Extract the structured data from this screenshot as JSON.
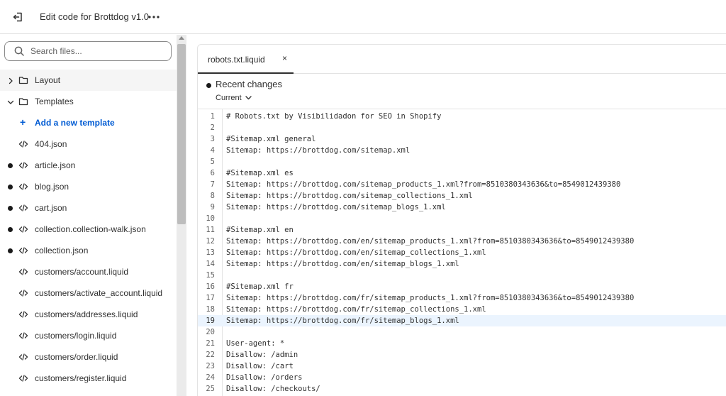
{
  "topbar": {
    "title": "Edit code for Brottdog v1.0",
    "exit_icon": "exit-icon",
    "more_icon": "more-horizontal-icon"
  },
  "sidebar": {
    "search_placeholder": "Search files...",
    "items": [
      {
        "type": "folder",
        "label": "Layout",
        "expanded": false
      },
      {
        "type": "folder",
        "label": "Templates",
        "expanded": true
      },
      {
        "type": "action",
        "label": "Add a new template"
      },
      {
        "type": "file",
        "label": "404.json",
        "modified": false
      },
      {
        "type": "file",
        "label": "article.json",
        "modified": true
      },
      {
        "type": "file",
        "label": "blog.json",
        "modified": true
      },
      {
        "type": "file",
        "label": "cart.json",
        "modified": true
      },
      {
        "type": "file",
        "label": "collection.collection-walk.json",
        "modified": true
      },
      {
        "type": "file",
        "label": "collection.json",
        "modified": true
      },
      {
        "type": "file",
        "label": "customers/account.liquid",
        "modified": false
      },
      {
        "type": "file",
        "label": "customers/activate_account.liquid",
        "modified": false
      },
      {
        "type": "file",
        "label": "customers/addresses.liquid",
        "modified": false
      },
      {
        "type": "file",
        "label": "customers/login.liquid",
        "modified": false
      },
      {
        "type": "file",
        "label": "customers/order.liquid",
        "modified": false
      },
      {
        "type": "file",
        "label": "customers/register.liquid",
        "modified": false
      }
    ]
  },
  "editor": {
    "tab_label": "robots.txt.liquid",
    "tab_close": "×",
    "changes_title": "Recent changes",
    "version": "Current",
    "active_line": 19,
    "lines": [
      "# Robots.txt by Visibilidadon for SEO in Shopify",
      "",
      "#Sitemap.xml general",
      "Sitemap: https://brottdog.com/sitemap.xml",
      "",
      "#Sitemap.xml es",
      "Sitemap: https://brottdog.com/sitemap_products_1.xml?from=8510380343636&to=8549012439380",
      "Sitemap: https://brottdog.com/sitemap_collections_1.xml",
      "Sitemap: https://brottdog.com/sitemap_blogs_1.xml",
      "",
      "#Sitemap.xml en",
      "Sitemap: https://brottdog.com/en/sitemap_products_1.xml?from=8510380343636&to=8549012439380",
      "Sitemap: https://brottdog.com/en/sitemap_collections_1.xml",
      "Sitemap: https://brottdog.com/en/sitemap_blogs_1.xml",
      "",
      "#Sitemap.xml fr",
      "Sitemap: https://brottdog.com/fr/sitemap_products_1.xml?from=8510380343636&to=8549012439380",
      "Sitemap: https://brottdog.com/fr/sitemap_collections_1.xml",
      "Sitemap: https://brottdog.com/fr/sitemap_blogs_1.xml",
      "",
      "User-agent: *",
      "Disallow: /admin",
      "Disallow: /cart",
      "Disallow: /orders",
      "Disallow: /checkouts/"
    ]
  }
}
